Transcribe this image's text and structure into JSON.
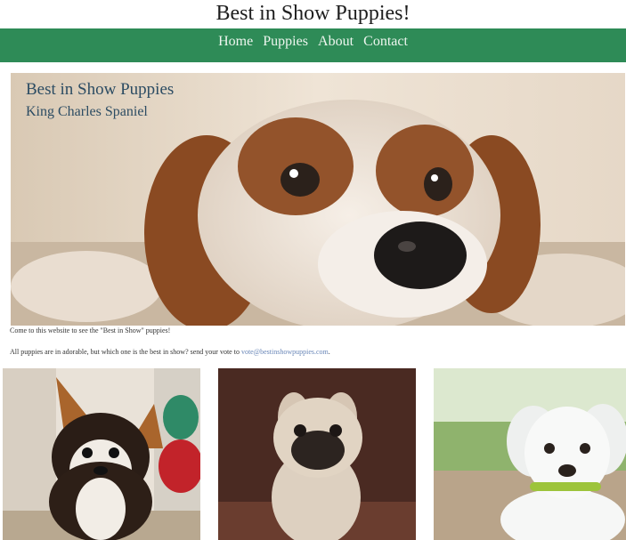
{
  "header": {
    "title": "Best in Show Puppies!"
  },
  "nav": {
    "items": [
      {
        "label": "Home"
      },
      {
        "label": "Puppies"
      },
      {
        "label": "About"
      },
      {
        "label": "Contact"
      }
    ],
    "bg_color": "#2e8b57"
  },
  "hero": {
    "title": "Best in Show Puppies",
    "subtitle": "King Charles Spaniel"
  },
  "content": {
    "intro": "Come to this website to see the \"Best in Show\" puppies!",
    "vote_prefix": "All puppies are in adorable, but which one is the best in show? send your vote to ",
    "vote_email": "vote@bestinshowpuppies.com",
    "vote_suffix": "."
  },
  "gallery": {
    "items": [
      {
        "icon": "corgi-puppy-photo"
      },
      {
        "icon": "pug-puppy-photo"
      },
      {
        "icon": "white-puppy-photo"
      }
    ]
  }
}
